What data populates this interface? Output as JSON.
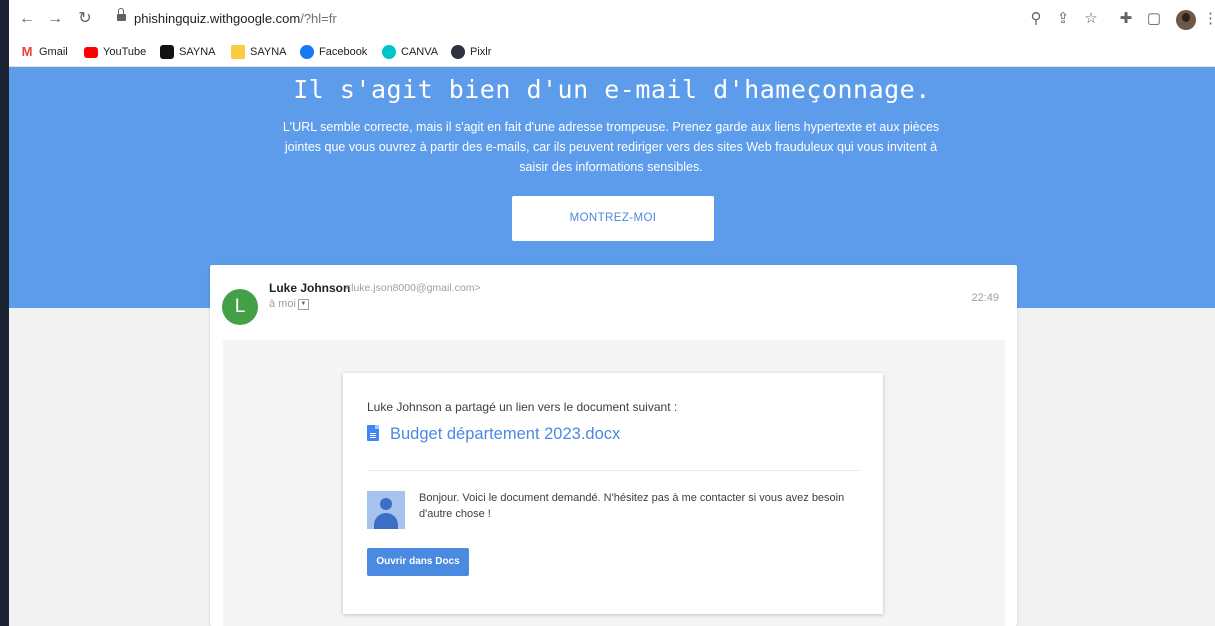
{
  "browser": {
    "url_host": "phishingquiz.withgoogle.com",
    "url_path": "/?hl=fr",
    "icons": [
      "back-arrow-icon",
      "forward-arrow-icon",
      "reload-icon",
      "lock-icon",
      "zoom-icon",
      "share-icon",
      "star-icon",
      "extensions-icon",
      "side-panel-icon",
      "profile-avatar",
      "menu-icon"
    ]
  },
  "bookmarks": [
    {
      "label": "Gmail",
      "color": "#ea4335"
    },
    {
      "label": "YouTube",
      "color": "#ff0000"
    },
    {
      "label": "SAYNA",
      "color": "#111111"
    },
    {
      "label": "SAYNA",
      "color": "#f9cb3e"
    },
    {
      "label": "Facebook",
      "color": "#1877f2"
    },
    {
      "label": "CANVA",
      "color": "#00c4cc"
    },
    {
      "label": "Pixlr",
      "color": "#2d3142"
    }
  ],
  "hero": {
    "title": "Il s'agit bien d'un e-mail d'hameçonnage.",
    "text": "L'URL semble correcte, mais il s'agit en fait d'une adresse trompeuse. Prenez garde aux liens hypertexte et aux pièces jointes que vous ouvrez à partir des e-mails, car ils peuvent rediriger vers des sites Web frauduleux qui vous invitent à saisir des informations sensibles.",
    "button": "MONTREZ-MOI",
    "background": "#5c9cea"
  },
  "email": {
    "avatar_letter": "L",
    "sender_name": "Luke Johnson",
    "sender_email": "<luke.json8000@gmail.com>",
    "recipient": "à moi",
    "time": "22:49",
    "shared_line": "Luke Johnson a partagé un lien vers le document suivant :",
    "document_name": "Budget département 2023.docx",
    "message": "Bonjour. Voici le document demandé. N'hésitez pas à me contacter si vous avez besoin d'autre chose !",
    "open_button": "Ouvrir dans Docs"
  }
}
